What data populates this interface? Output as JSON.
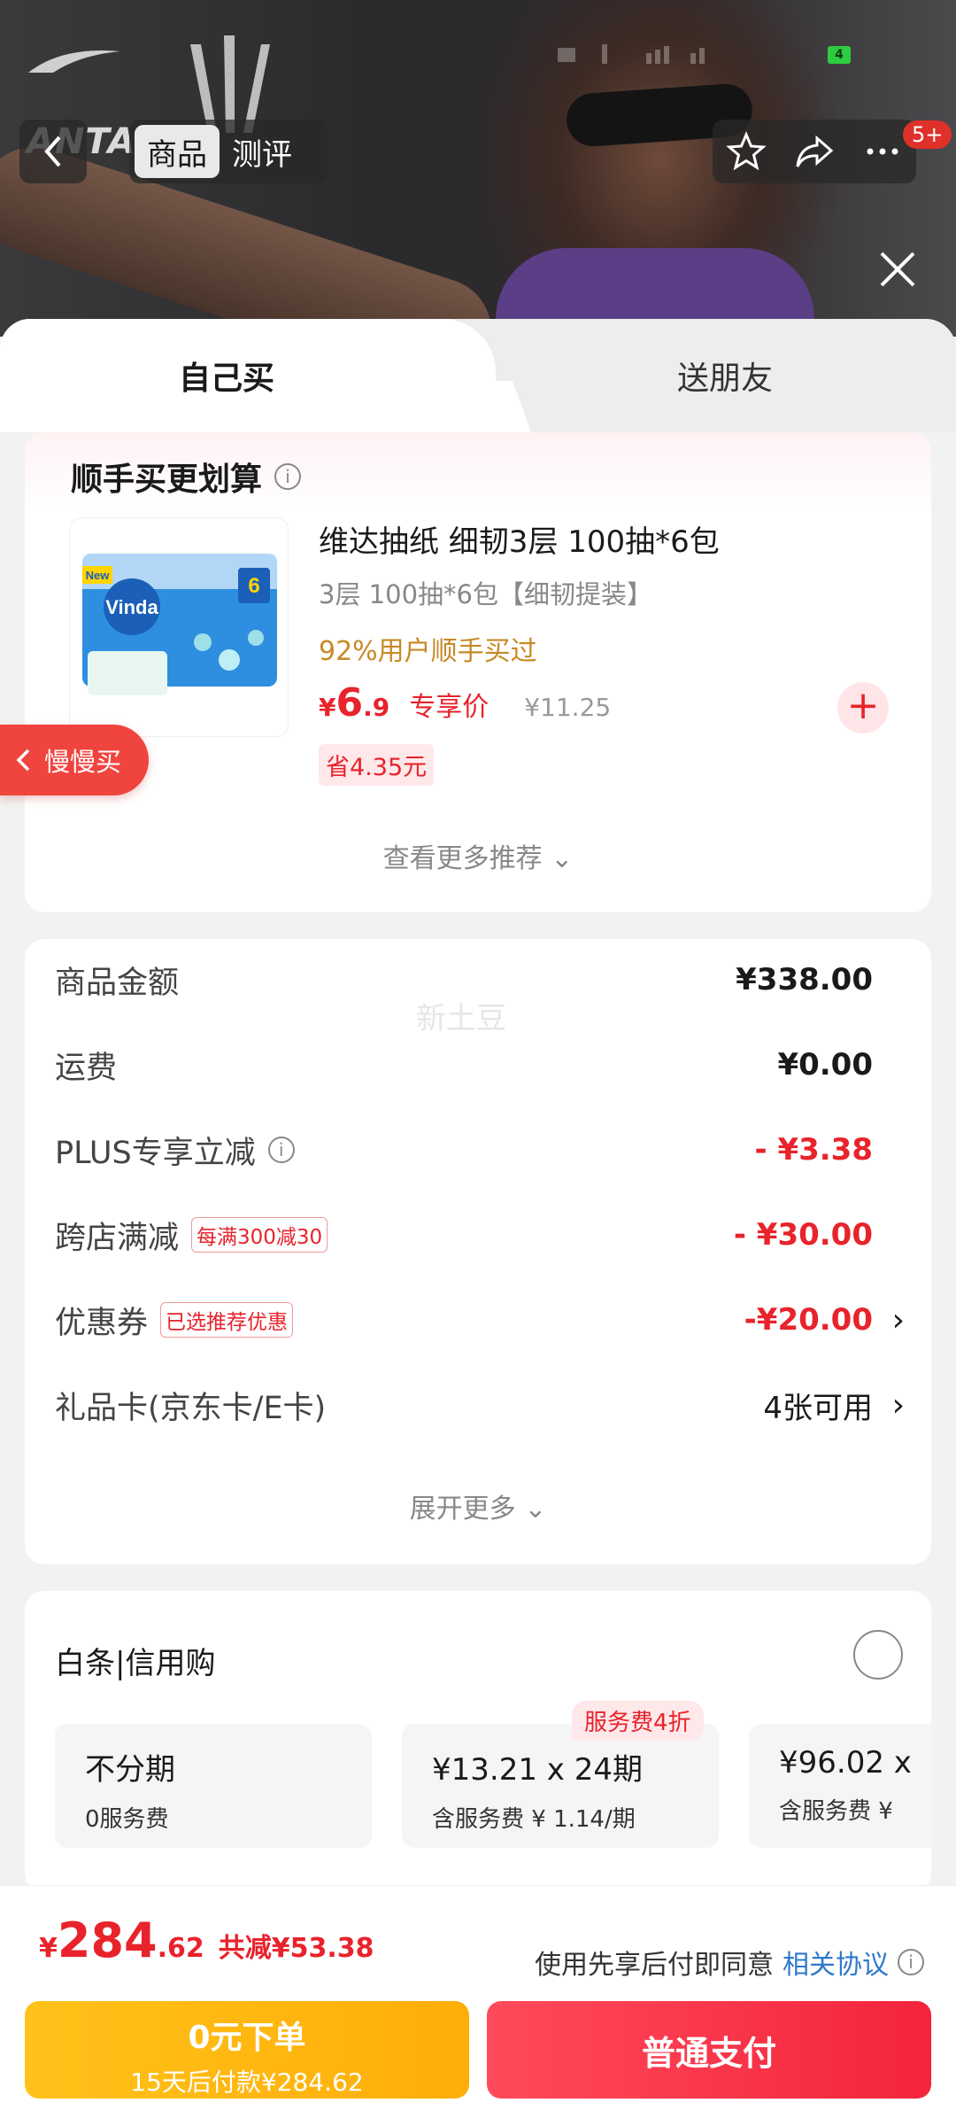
{
  "header": {
    "brand_text": "ANTA",
    "tabs": [
      {
        "label": "商品"
      },
      {
        "label": "测评"
      }
    ],
    "message_badge": "5+"
  },
  "sheet": {
    "tabs": [
      {
        "label": "自己买"
      },
      {
        "label": "送朋友"
      }
    ]
  },
  "addon": {
    "title": "顺手买更划算",
    "product": {
      "name": "维达抽纸 细韧3层 100抽*6包",
      "spec": "3层 100抽*6包【细韧提装】",
      "bought_ratio": "92%用户顺手买过",
      "price_symbol": "¥",
      "price_int": "6",
      "price_dec": ".9",
      "price_tag": "专享价",
      "original_price": "¥11.25",
      "save": "省4.35元",
      "image_label": "Vinda",
      "image_badge": "New"
    },
    "more_label": "查看更多推荐 ⌄"
  },
  "slow_buy_label": "慢慢买",
  "summary": {
    "watermark": "新土豆",
    "rows": [
      {
        "label": "商品金额",
        "value": "¥338.00"
      },
      {
        "label": "运费",
        "value": "¥0.00"
      },
      {
        "label": "PLUS专享立减",
        "value": "- ¥3.38"
      },
      {
        "label": "跨店满减",
        "tag": "每满300减30",
        "value": "- ¥30.00"
      },
      {
        "label": "优惠券",
        "tag": "已选推荐优惠",
        "value": "-¥20.00"
      },
      {
        "label": "礼品卡(京东卡/E卡)",
        "value": "4张可用"
      }
    ],
    "expand_label": "展开更多 ⌄"
  },
  "credit": {
    "title": "白条|信用购",
    "plan_tag": "服务费4折",
    "plans": [
      {
        "line1": "不分期",
        "line2": "0服务费"
      },
      {
        "line1": "¥13.21 x 24期",
        "line2": "含服务费 ¥ 1.14/期"
      },
      {
        "line1": "¥96.02 x",
        "line2": "含服务费 ¥"
      }
    ]
  },
  "bottom": {
    "total_symbol": "¥",
    "total_int": "284",
    "total_dec": ".62",
    "total_discount": "共减¥53.38",
    "agree_text": "使用先享后付即同意",
    "agree_link": "相关协议",
    "zero_line1": "0元下单",
    "zero_line2": "15天后付款¥284.62",
    "pay_label": "普通支付"
  },
  "colors": {
    "accent_red": "#e8232b",
    "pay_button": "#f3243c",
    "zero_button": "#ffb50f",
    "link_blue": "#2f79c9"
  }
}
